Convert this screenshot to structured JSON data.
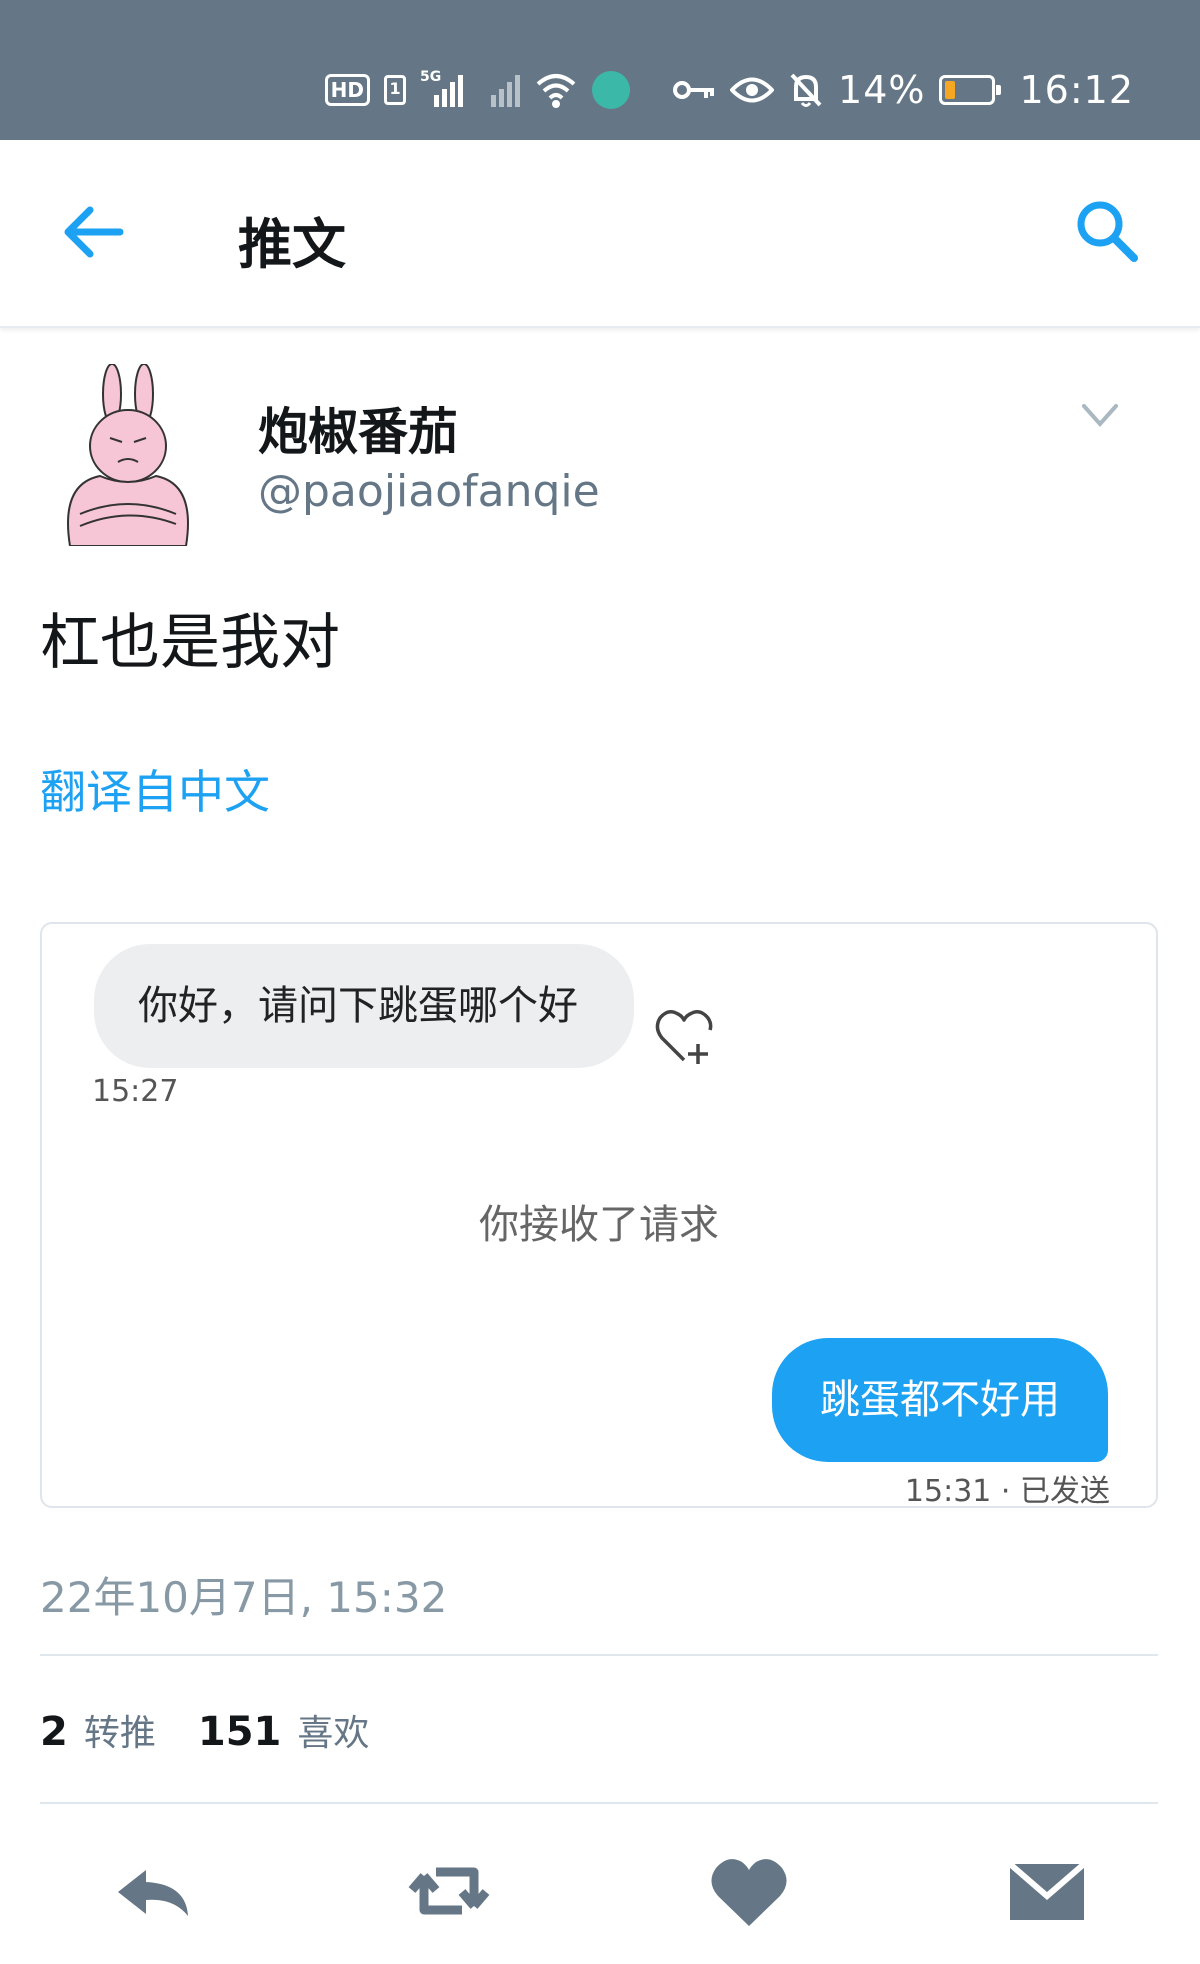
{
  "status_bar": {
    "hd": "HD",
    "sim": "1",
    "net": "5G",
    "battery_percent": "14%",
    "battery_level": 0.14,
    "time": "16:12"
  },
  "header": {
    "title": "推文",
    "back_icon": "arrow-left-icon",
    "search_icon": "search-icon"
  },
  "tweet": {
    "display_name": "炮椒番茄",
    "handle": "@paojiaofanqie",
    "text": "杠也是我对",
    "translate_link": "翻译自中文",
    "timestamp": "22年10月7日, 15:32"
  },
  "chat": {
    "incoming_message": "你好，请问下跳蛋哪个好",
    "incoming_time": "15:27",
    "system_message": "你接收了请求",
    "outgoing_message": "跳蛋都不好用",
    "outgoing_status": "15:31 · 已发送"
  },
  "stats": {
    "retweets": "2",
    "retweets_label": "转推",
    "likes": "151",
    "likes_label": "喜欢"
  },
  "colors": {
    "accent": "#1da1f2",
    "status_bar": "#657786",
    "battery_low": "#f5a623"
  }
}
